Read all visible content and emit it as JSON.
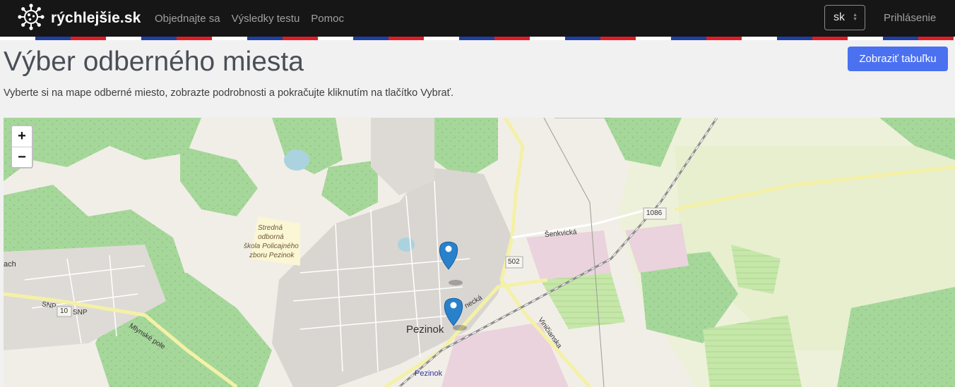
{
  "brand": {
    "name": "rýchlejšie.sk",
    "logo_icon": "virus-icon"
  },
  "nav": {
    "items": [
      "Objednajte sa",
      "Výsledky testu",
      "Pomoc"
    ],
    "login": "Prihlásenie"
  },
  "language": {
    "selected": "sk"
  },
  "page": {
    "title": "Výber odberného miesta",
    "subtitle": "Vyberte si na mape odberné miesto, zobrazte podrobnosti a pokračujte kliknutím na tlačítko Vybrať.",
    "table_button": "Zobraziť tabuľku"
  },
  "map": {
    "zoom_in": "+",
    "zoom_out": "−",
    "labels": {
      "town": "Pezinok",
      "station": "Pezinok",
      "road_1086": "1086",
      "road_502": "502",
      "road_10": "10",
      "snp_left": "SNP",
      "snp_right": "SNP",
      "mlynske": "Mlynské pole",
      "senkvicka": "Šenkvická",
      "vinicianska": "Viničianska",
      "limbacka": "necká",
      "school_1": "Stredná",
      "school_2": "odborná",
      "school_3": "škola Policajného",
      "school_4": "zboru Pezinok",
      "left_edge": "ach"
    },
    "markers": [
      "map-marker-icon",
      "map-marker-icon"
    ]
  }
}
